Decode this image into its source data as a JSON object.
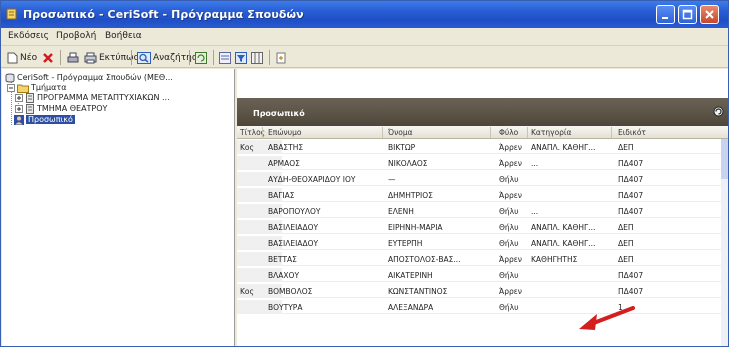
{
  "window": {
    "title": "Προσωπικό - CeriSoft - Πρόγραμμα Σπουδών",
    "minimize_label": "Ελαχιστοποίηση",
    "maximize_label": "Μεγιστοποίηση",
    "close_label": "Κλείσιμο"
  },
  "menu": [
    "Εκδόσεις",
    "Προβολή",
    "Βοήθεια"
  ],
  "toolbar": {
    "new_label": "Νέο",
    "delete_label": "",
    "print_label": "Εκτύπωση",
    "search_label": "Αναζήτηση"
  },
  "tree": {
    "root": "CeriSoft - Πρόγραμμα Σπουδών (ΜΕΘ...",
    "group": "Τμήματα",
    "child1": "ΠΡΟΓΡΑΜΜΑ ΜΕΤΑΠΤΥΧΙΑΚΩΝ ...",
    "child2": "ΤΜΗΜΑ ΘΕΑΤΡΟΥ",
    "selected": "Προσωπικό"
  },
  "pane": {
    "title": "Προσωπικό"
  },
  "grid": {
    "headers": [
      "Τίτλος",
      "Επώνυμο",
      "Όνομα",
      "Φύλο",
      "Κατηγορία",
      "Ειδικότ"
    ],
    "rows": [
      [
        "Κος",
        "ΑΒΑΣΤΗΣ",
        "ΒΙΚΤΩΡ",
        "Άρρεν",
        "ΑΝΑΠΛ. ΚΑΘΗΓ...",
        "ΔΕΠ"
      ],
      [
        "",
        "ΑΡΜΑΟΣ",
        "ΝΙΚΟΛΑΟΣ",
        "Άρρεν",
        "...",
        "ΠΔ407"
      ],
      [
        "",
        "ΑΥΔΗ-ΘΕΟΧΑΡΙΔΟΥ ΙΟΥ",
        "—",
        "Θήλυ",
        "",
        "ΠΔ407"
      ],
      [
        "",
        "ΒΑΓΙΑΣ",
        "ΔΗΜΗΤΡΙΟΣ",
        "Άρρεν",
        "",
        "ΠΔ407"
      ],
      [
        "",
        "ΒΑΡΟΠΟΥΛΟΥ",
        "ΕΛΕΝΗ",
        "Θήλυ",
        "...",
        "ΠΔ407"
      ],
      [
        "",
        "ΒΑΣΙΛΕΙΑΔΟΥ",
        "ΕΙΡΗΝΗ-ΜΑΡΙΑ",
        "Θήλυ",
        "ΑΝΑΠΛ. ΚΑΘΗΓ...",
        "ΔΕΠ"
      ],
      [
        "",
        "ΒΑΣΙΛΕΙΑΔΟΥ",
        "ΕΥΤΕΡΠΗ",
        "Θήλυ",
        "ΑΝΑΠΛ. ΚΑΘΗΓ...",
        "ΔΕΠ"
      ],
      [
        "",
        "ΒΕΤΤΑΣ",
        "ΑΠΟΣΤΟΛΟΣ-ΒΑΣ...",
        "Άρρεν",
        "ΚΑΘΗΓΗΤΗΣ",
        "ΔΕΠ"
      ],
      [
        "",
        "ΒΛΑΧΟΥ",
        "ΑΙΚΑΤΕΡΙΝΗ",
        "Θήλυ",
        "",
        "ΠΔ407"
      ],
      [
        "Κος",
        "ΒΟΜΒΟΛΟΣ",
        "ΚΩΝΣΤΑΝΤΙΝΟΣ",
        "Άρρεν",
        "",
        "ΠΔ407"
      ],
      [
        "",
        "ΒΟΥΤΥΡΑ",
        "ΑΛΕΞΑΝΔΡΑ",
        "Θήλυ",
        "",
        "1"
      ]
    ]
  },
  "colors": {
    "title_bar": "#2a5fd6",
    "pane_header": "#4d463a",
    "annotation_arrow": "#d31f1f"
  }
}
